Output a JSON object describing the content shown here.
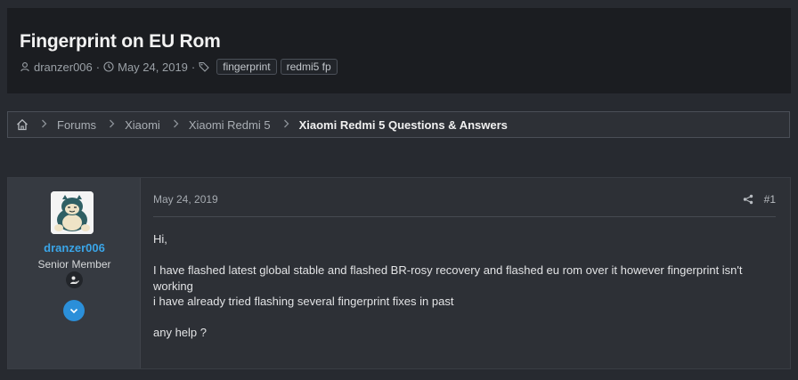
{
  "thread": {
    "title": "Fingerprint on EU Rom",
    "author": "dranzer006",
    "date": "May 24, 2019",
    "separator": "·",
    "tags": [
      "fingerprint",
      "redmi5 fp"
    ]
  },
  "breadcrumb": {
    "home_icon": "home-icon",
    "items": [
      "Forums",
      "Xiaomi",
      "Xiaomi Redmi 5"
    ],
    "current": "Xiaomi Redmi 5 Questions & Answers"
  },
  "post": {
    "date": "May 24, 2019",
    "number": "#1",
    "share_icon": "share-icon",
    "user": {
      "name": "dranzer006",
      "title": "Senior Member",
      "badge_icon": "member-badge-icon",
      "expand_icon": "chevron-down-icon"
    },
    "body": {
      "greeting": "Hi,",
      "line1": "I have flashed latest global stable and flashed BR-rosy recovery and flashed eu rom over it however fingerprint isn't working",
      "line2": "i have already tried flashing several fingerprint fixes in past",
      "line3": "any help ?"
    }
  },
  "colors": {
    "background": "#272a30",
    "header": "#1b1d21",
    "accent": "#3aa5e8",
    "button": "#2b8fd9"
  }
}
